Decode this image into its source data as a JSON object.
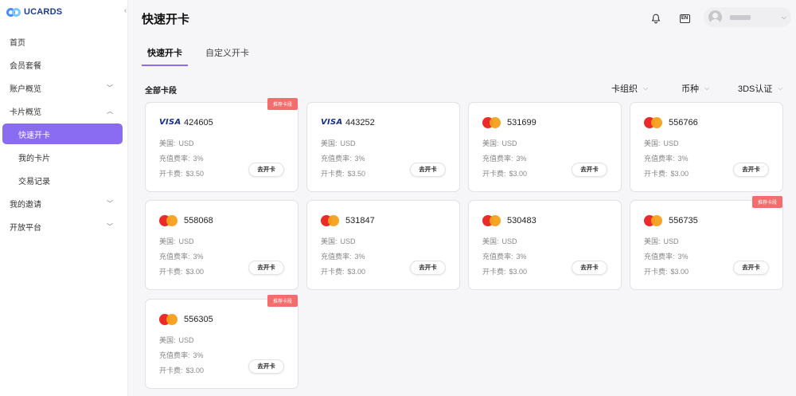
{
  "app": {
    "logo_text": "UCARDS"
  },
  "sidebar": {
    "items": [
      {
        "label": "首页",
        "expandable": false
      },
      {
        "label": "会员套餐",
        "expandable": false
      },
      {
        "label": "账户概览",
        "expandable": true,
        "expanded": false
      },
      {
        "label": "卡片概览",
        "expandable": true,
        "expanded": true
      },
      {
        "label": "快速开卡",
        "sub": true,
        "active": true
      },
      {
        "label": "我的卡片",
        "sub": true
      },
      {
        "label": "交易记录",
        "sub": true
      },
      {
        "label": "我的邀请",
        "expandable": true,
        "expanded": false
      },
      {
        "label": "开放平台",
        "expandable": true,
        "expanded": false
      }
    ]
  },
  "header": {
    "title": "快速开卡",
    "lang_label": "EN"
  },
  "tabs": [
    {
      "label": "快速开卡",
      "active": true
    },
    {
      "label": "自定义开卡",
      "active": false
    }
  ],
  "section": {
    "label": "全部卡段",
    "filters": [
      "卡组织",
      "币种",
      "3DS认证"
    ]
  },
  "card_labels": {
    "country": "美国:",
    "rate": "充值费率:",
    "fee": "开卡费:",
    "button": "去开卡",
    "badge": "推荐卡段"
  },
  "cards": [
    {
      "brand": "visa",
      "brand_text": "VISA",
      "bin": "424605",
      "currency": "USD",
      "rate": "3%",
      "fee": "$3.50",
      "recommended": true
    },
    {
      "brand": "visa",
      "brand_text": "VISA",
      "bin": "443252",
      "currency": "USD",
      "rate": "3%",
      "fee": "$3.50",
      "recommended": false
    },
    {
      "brand": "mastercard",
      "bin": "531699",
      "currency": "USD",
      "rate": "3%",
      "fee": "$3.00",
      "recommended": false
    },
    {
      "brand": "mastercard",
      "bin": "556766",
      "currency": "USD",
      "rate": "3%",
      "fee": "$3.00",
      "recommended": false
    },
    {
      "brand": "mastercard",
      "bin": "558068",
      "currency": "USD",
      "rate": "3%",
      "fee": "$3.00",
      "recommended": false
    },
    {
      "brand": "mastercard",
      "bin": "531847",
      "currency": "USD",
      "rate": "3%",
      "fee": "$3.00",
      "recommended": false
    },
    {
      "brand": "mastercard",
      "bin": "530483",
      "currency": "USD",
      "rate": "3%",
      "fee": "$3.00",
      "recommended": false
    },
    {
      "brand": "mastercard",
      "bin": "556735",
      "currency": "USD",
      "rate": "3%",
      "fee": "$3.00",
      "recommended": true
    },
    {
      "brand": "mastercard",
      "bin": "556305",
      "currency": "USD",
      "rate": "3%",
      "fee": "$3.00",
      "recommended": true
    }
  ],
  "colors": {
    "accent": "#8a6cf2",
    "badge": "#f26d6d",
    "visa": "#1a2f8c",
    "mc_red": "#eb2a2a",
    "mc_orange": "#f6a01a"
  },
  "icons": {
    "bell": "bell-icon",
    "language": "language-icon",
    "avatar": "user-avatar-icon",
    "chevron": "chevron-down-icon"
  }
}
